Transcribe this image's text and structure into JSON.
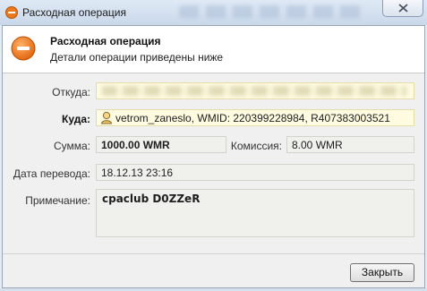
{
  "window": {
    "title": "Расходная операция",
    "icon": "minus-circle-icon"
  },
  "header": {
    "title": "Расходная операция",
    "subtitle": "Детали операции приведены ниже",
    "icon": "minus-circle-icon"
  },
  "form": {
    "from_label": "Откуда:",
    "to_label": "Куда:",
    "to_value": "vetrom_zaneslo, WMID: 220399228984, R407383003521",
    "amount_label": "Сумма:",
    "amount_value": "1000.00 WMR",
    "fee_label": "Комиссия:",
    "fee_value": "8.00 WMR",
    "date_label": "Дата перевода:",
    "date_value": "18.12.13 23:16",
    "note_label": "Примечание:",
    "note_value": "cpaclub D0ZZeR"
  },
  "footer": {
    "close_label": "Закрыть"
  },
  "colors": {
    "accent_icon": "#e8751a",
    "highlight_field": "#fffbe1"
  }
}
